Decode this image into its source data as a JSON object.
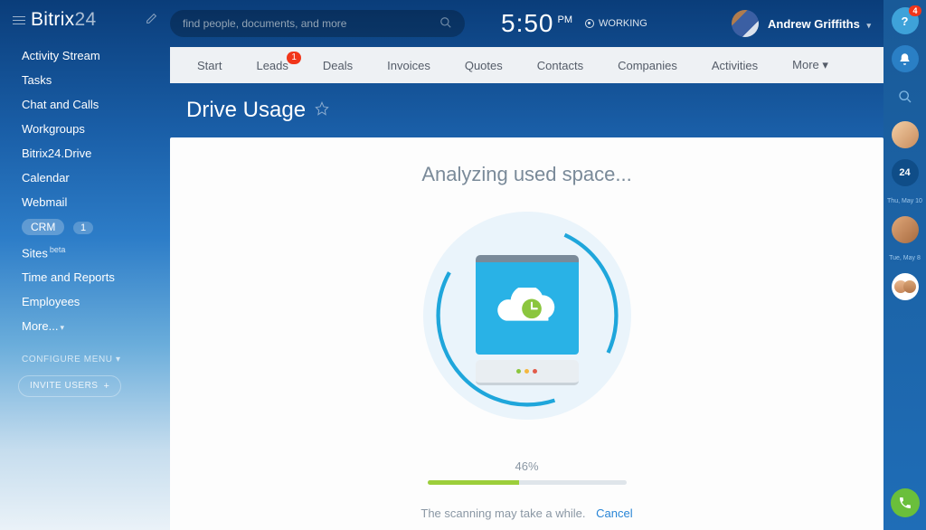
{
  "brand": {
    "name_a": "Bitrix",
    "name_b": "24"
  },
  "search": {
    "placeholder": "find people, documents, and more"
  },
  "clock": {
    "time": "5:50",
    "ampm": "PM",
    "status": "WORKING"
  },
  "user": {
    "name": "Andrew Griffiths"
  },
  "sidebar": {
    "items": [
      {
        "label": "Activity Stream"
      },
      {
        "label": "Tasks"
      },
      {
        "label": "Chat and Calls"
      },
      {
        "label": "Workgroups"
      },
      {
        "label": "Bitrix24.Drive"
      },
      {
        "label": "Calendar"
      },
      {
        "label": "Webmail"
      },
      {
        "label": "CRM",
        "active": true,
        "count": "1"
      },
      {
        "label": "Sites",
        "beta": "beta"
      },
      {
        "label": "Time and Reports"
      },
      {
        "label": "Employees"
      },
      {
        "label": "More..."
      }
    ],
    "configure": "CONFIGURE MENU",
    "invite": "INVITE USERS"
  },
  "subnav": {
    "tabs": [
      {
        "label": "Start"
      },
      {
        "label": "Leads",
        "badge": "1"
      },
      {
        "label": "Deals"
      },
      {
        "label": "Invoices"
      },
      {
        "label": "Quotes"
      },
      {
        "label": "Contacts"
      },
      {
        "label": "Companies"
      },
      {
        "label": "Activities"
      }
    ],
    "more": "More"
  },
  "page": {
    "title": "Drive Usage",
    "analyzing": "Analyzing used space...",
    "progress_pct": "46%",
    "progress_width": "46%",
    "note": "The scanning may take a while.",
    "cancel": "Cancel"
  },
  "rail": {
    "help_badge": "4",
    "b24": "24",
    "date1": "Thu, May 10",
    "date2": "Tue, May 8"
  }
}
